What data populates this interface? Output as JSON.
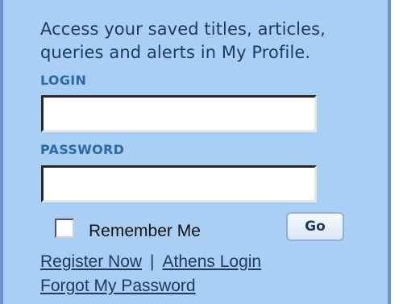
{
  "intro": {
    "line1": "Access your saved titles, articles,",
    "line2": "queries and alerts in My Profile."
  },
  "login": {
    "label": "LOGIN",
    "value": ""
  },
  "password": {
    "label": "PASSWORD",
    "value": ""
  },
  "remember": {
    "label": "Remember Me",
    "checked": false
  },
  "go_button": {
    "label": "Go"
  },
  "links": {
    "register": "Register Now",
    "separator": "|",
    "athens": "Athens Login",
    "forgot": "Forgot My Password"
  }
}
